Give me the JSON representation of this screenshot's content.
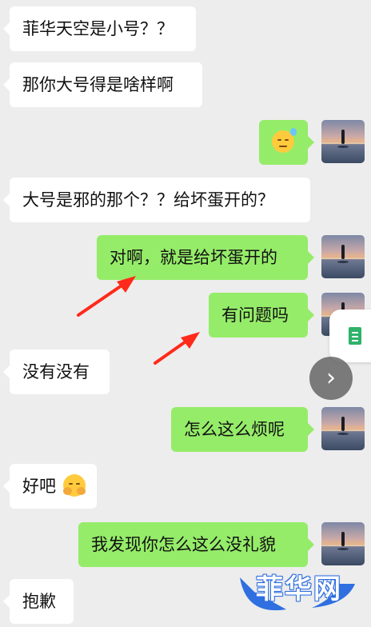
{
  "messages": [
    {
      "side": "left",
      "text": "菲华天空是小号？？"
    },
    {
      "side": "left",
      "text": "那你大号得是啥样啊"
    },
    {
      "side": "right",
      "text": "",
      "emoji": "sweat-smile-emoji"
    },
    {
      "side": "left",
      "text": "大号是邪的那个？？给坏蛋开的？"
    },
    {
      "side": "right",
      "text": "对啊，就是给坏蛋开的"
    },
    {
      "side": "right",
      "text": "有问题吗"
    },
    {
      "side": "left",
      "text": "没有没有"
    },
    {
      "side": "right",
      "text": "怎么这么烦呢"
    },
    {
      "side": "left",
      "text": "好吧",
      "emoji": "embarrassed-emoji"
    },
    {
      "side": "right",
      "text": "我发现你怎么这么没礼貌"
    },
    {
      "side": "left",
      "text": "抱歉"
    }
  ],
  "watermark": {
    "text": "菲华网",
    "color": "#2f6fe0"
  },
  "icons": {
    "side_card": "document-icon",
    "next": "chevron-right-icon",
    "annotation": "red-arrow-icon"
  },
  "colors": {
    "background": "#ededed",
    "incoming_bubble": "#ffffff",
    "outgoing_bubble": "#95ec69",
    "arrow": "#ff2a1a"
  }
}
